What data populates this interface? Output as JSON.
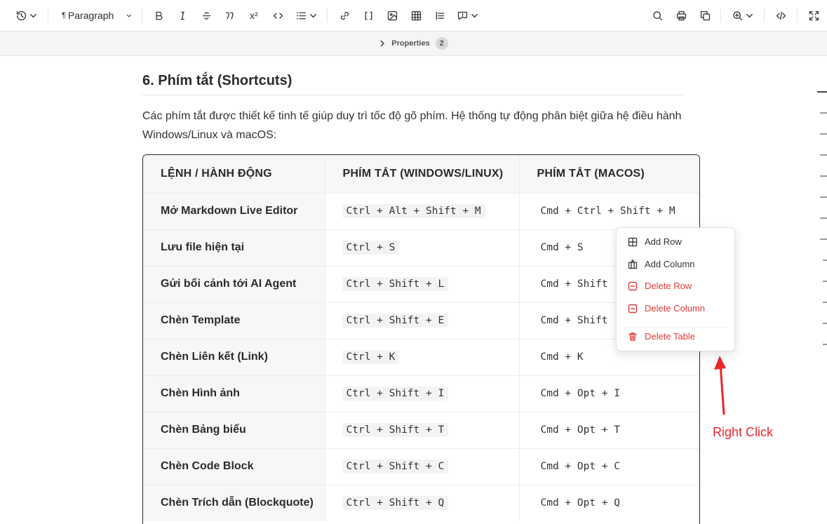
{
  "toolbar": {
    "paragraph_label": "Paragraph",
    "icons": [
      "history-icon",
      "bold-icon",
      "italic-icon",
      "strikethrough-icon",
      "quote-icon",
      "superscript-icon",
      "code-icon",
      "list-icon",
      "link-icon",
      "bracket-icon",
      "image-icon",
      "table-icon",
      "align-icon",
      "comment-icon",
      "search-icon",
      "print-icon",
      "copy-icon",
      "zoom-icon",
      "source-code-icon",
      "fullscreen-icon"
    ]
  },
  "properties": {
    "label": "Properties",
    "count": "2"
  },
  "heading": "6. Phím tắt (Shortcuts)",
  "paragraph": "Các phím tắt được thiết kế tinh tế giúp duy trì tốc độ gõ phím. Hệ thống tự động phân biệt giữa hệ điều hành Windows/Linux và macOS:",
  "table": {
    "headers": [
      "LỆNH / HÀNH ĐỘNG",
      "PHÍM TẮT (WINDOWS/LINUX)",
      "PHÍM TẮT (MACOS)"
    ],
    "rows": [
      {
        "cmd": "Mở Markdown Live Editor",
        "win": "Ctrl + Alt + Shift + M",
        "mac": "Cmd + Ctrl + Shift + M"
      },
      {
        "cmd": "Lưu file hiện tại",
        "win": "Ctrl + S",
        "mac": "Cmd + S"
      },
      {
        "cmd": "Gửi bối cảnh tới AI Agent",
        "win": "Ctrl + Shift + L",
        "mac": "Cmd + Shift"
      },
      {
        "cmd": "Chèn Template",
        "win": "Ctrl + Shift + E",
        "mac": "Cmd + Shift"
      },
      {
        "cmd": "Chèn Liên kết (Link)",
        "win": "Ctrl + K",
        "mac": "Cmd + K"
      },
      {
        "cmd": "Chèn Hình ảnh",
        "win": "Ctrl + Shift + I",
        "mac": "Cmd + Opt + I"
      },
      {
        "cmd": "Chèn Bảng biểu",
        "win": "Ctrl + Shift + T",
        "mac": "Cmd + Opt + T"
      },
      {
        "cmd": "Chèn Code Block",
        "win": "Ctrl + Shift + C",
        "mac": "Cmd + Opt + C"
      },
      {
        "cmd": "Chèn Trích dẫn (Blockquote)",
        "win": "Ctrl + Shift + Q",
        "mac": "Cmd + Opt + Q"
      }
    ]
  },
  "context_menu": {
    "add_row": "Add Row",
    "add_column": "Add Column",
    "delete_row": "Delete Row",
    "delete_column": "Delete Column",
    "delete_table": "Delete Table"
  },
  "annotation": {
    "text": "Right Click",
    "color": "#e8262a"
  },
  "colors": {
    "danger": "#e03a3a",
    "border": "#2e2e2e",
    "header_bg": "#f7f7f8"
  }
}
